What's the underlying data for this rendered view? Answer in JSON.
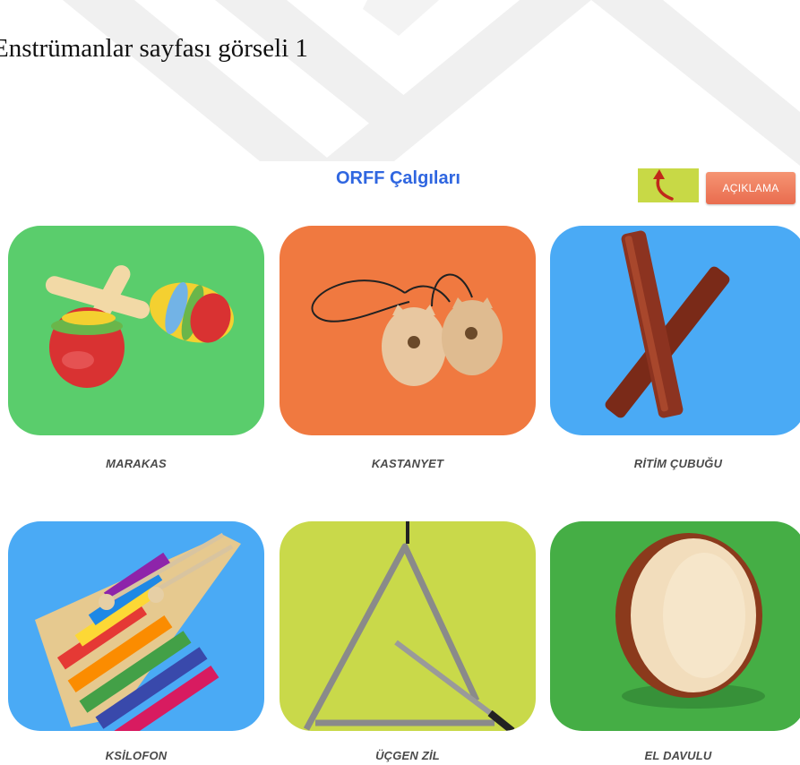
{
  "caption": "Enstrümanlar sayfası görseli 1",
  "header": {
    "title": "ORFF Çalgıları",
    "info_button": "AÇIKLAMA"
  },
  "instruments": [
    {
      "label": "MARAKAS",
      "bg": "#5acd6c",
      "icon": "maracas-icon"
    },
    {
      "label": "KASTANYET",
      "bg": "#f07940",
      "icon": "castanets-icon"
    },
    {
      "label": "RİTİM ÇUBUĞU",
      "bg": "#4aaaf5",
      "icon": "rhythm-sticks-icon"
    },
    {
      "label": "KSİLOFON",
      "bg": "#4aaaf5",
      "icon": "xylophone-icon"
    },
    {
      "label": "ÜÇGEN ZİL",
      "bg": "#c9d94a",
      "icon": "triangle-icon"
    },
    {
      "label": "EL DAVULU",
      "bg": "#45ae45",
      "icon": "hand-drum-icon"
    }
  ],
  "colors": {
    "title": "#2f66e0",
    "back_button": "#c8d946",
    "info_button": "#eb7352",
    "label_text": "#4a4a4a"
  }
}
